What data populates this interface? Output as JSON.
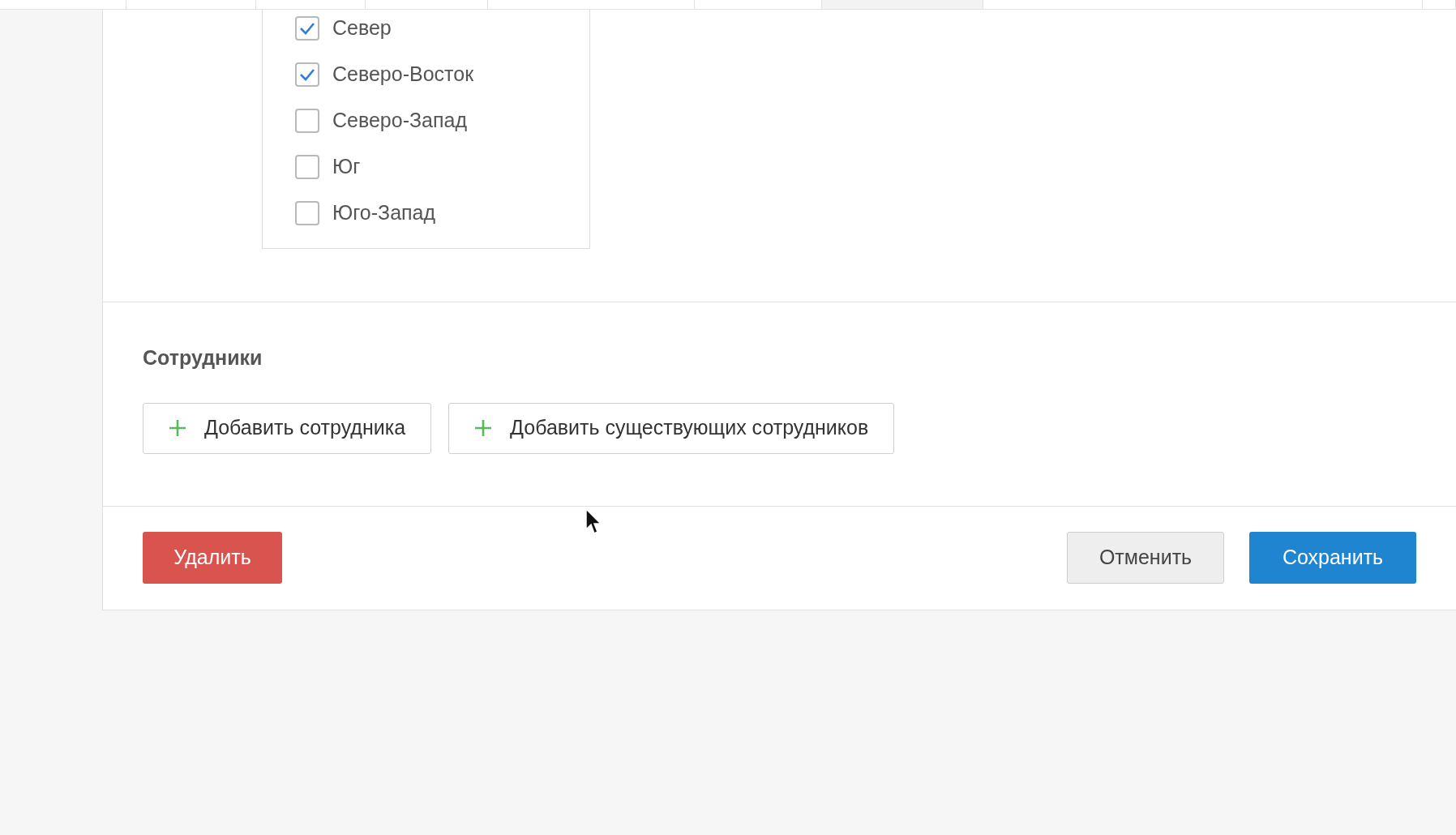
{
  "regions": [
    {
      "label": "Север",
      "checked": true
    },
    {
      "label": "Северо-Восток",
      "checked": true
    },
    {
      "label": "Северо-Запад",
      "checked": false
    },
    {
      "label": "Юг",
      "checked": false
    },
    {
      "label": "Юго-Запад",
      "checked": false
    }
  ],
  "employees": {
    "title": "Сотрудники",
    "buttons": [
      "Добавить сотрудника",
      "Добавить существующих сотрудников"
    ]
  },
  "footer": {
    "delete": "Удалить",
    "cancel": "Отменить",
    "save": "Сохранить"
  }
}
